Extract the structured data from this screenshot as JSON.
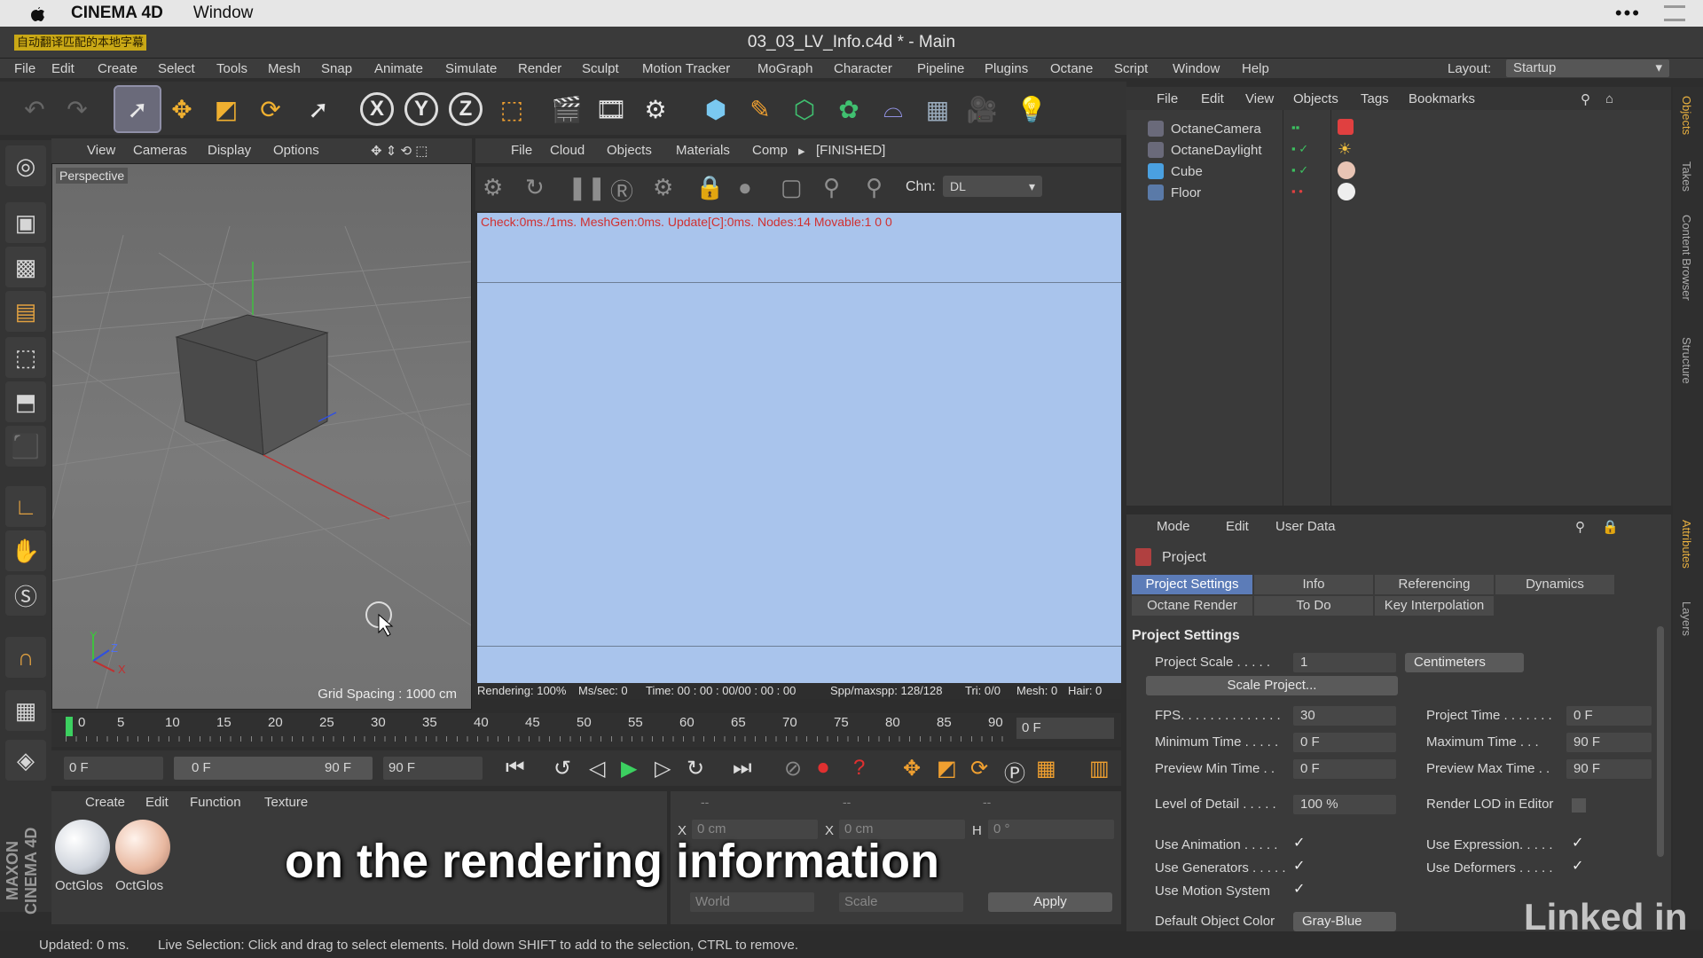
{
  "mac": {
    "app": "CINEMA 4D",
    "window_menu": "Window",
    "apple": "",
    "dots": "•••"
  },
  "window": {
    "title": "03_03_LV_Info.c4d * - Main",
    "watermark": "自动翻译匹配的本地字幕"
  },
  "menu": [
    "File",
    "Edit",
    "Create",
    "Select",
    "Tools",
    "Mesh",
    "Snap",
    "Animate",
    "Simulate",
    "Render",
    "Sculpt",
    "Motion Tracker",
    "MoGraph",
    "Character",
    "Pipeline",
    "Plugins",
    "Octane",
    "Script",
    "Window",
    "Help"
  ],
  "layout": {
    "label": "Layout:",
    "value": "Startup"
  },
  "toolbar": {
    "x": "X",
    "y": "Y",
    "z": "Z"
  },
  "viewport": {
    "menu": [
      "View",
      "Cameras",
      "Display",
      "Options"
    ],
    "label": "Perspective",
    "grid": "Grid Spacing : 1000 cm",
    "axis_y": "Y",
    "axis_z": "Z",
    "axis_x": "X"
  },
  "octane": {
    "menu": [
      "File",
      "Cloud",
      "Objects",
      "Materials",
      "Comp"
    ],
    "state": "[FINISHED]",
    "chn_label": "Chn:",
    "chn_value": "DL",
    "status": "Check:0ms./1ms. MeshGen:0ms. Update[C]:0ms. Nodes:14 Movable:1  0 0",
    "footer": {
      "rendering": "Rendering: 100%",
      "ms": "Ms/sec: 0",
      "time": "Time: 00 : 00 : 00/00 : 00 : 00",
      "spp": "Spp/maxspp: 128/128",
      "tri": "Tri: 0/0",
      "mesh": "Mesh: 0",
      "hair": "Hair: 0"
    }
  },
  "timeline": {
    "ticks": [
      "0",
      "5",
      "10",
      "15",
      "20",
      "25",
      "30",
      "35",
      "40",
      "45",
      "50",
      "55",
      "60",
      "65",
      "70",
      "75",
      "80",
      "85",
      "90"
    ],
    "frame": "0 F"
  },
  "playbar": {
    "start": "0 F",
    "range_start": "0 F",
    "range_end": "90 F",
    "end": "90 F"
  },
  "materials": {
    "menu": [
      "Create",
      "Edit",
      "Function",
      "Texture"
    ],
    "items": [
      {
        "name": "OctGlos"
      },
      {
        "name": "OctGlos"
      }
    ]
  },
  "coords": {
    "hdr": [
      "--",
      "--",
      "--"
    ],
    "x": "X",
    "x_val": "0 cm",
    "x2": "X",
    "x2_val": "0 cm",
    "h": "H",
    "h_val": "0 °",
    "world": "World",
    "scale": "Scale",
    "apply": "Apply"
  },
  "objects": {
    "menu": [
      "File",
      "Edit",
      "View",
      "Objects",
      "Tags",
      "Bookmarks"
    ],
    "items": [
      "OctaneCamera",
      "OctaneDaylight",
      "Cube",
      "Floor"
    ]
  },
  "attributes": {
    "menu": [
      "Mode",
      "Edit",
      "User Data"
    ],
    "title": "Project",
    "tabs": [
      "Project Settings",
      "Info",
      "Referencing",
      "Dynamics",
      "Octane Render",
      "To Do",
      "Key Interpolation"
    ],
    "section": "Project Settings",
    "project_scale_label": "Project Scale . . . . .",
    "project_scale": "1",
    "units": "Centimeters",
    "scale_btn": "Scale Project...",
    "fps_label": "FPS. . . . . . . . . . . . . .",
    "fps": "30",
    "ptime_label": "Project Time . . . . . . .",
    "ptime": "0 F",
    "mintime_label": "Minimum Time . . . . .",
    "mintime": "0 F",
    "maxtime_label": "Maximum Time . . .",
    "maxtime": "90 F",
    "pmin_label": "Preview Min Time . .",
    "pmin": "0 F",
    "pmax_label": "Preview Max Time . .",
    "pmax": "90 F",
    "lod_label": "Level of Detail . . . . .",
    "lod": "100 %",
    "rlod_label": "Render LOD in Editor",
    "useanim_label": "Use Animation . . . . .",
    "usegen_label": "Use Generators . . . . .",
    "usemotion_label": "Use Motion System",
    "useexpr_label": "Use Expression. . . . .",
    "usedef_label": "Use Deformers . . . . .",
    "objcolor_label": "Default Object Color",
    "objcolor": "Gray-Blue",
    "check": "✓"
  },
  "vtabs": [
    "Objects",
    "Takes",
    "Content Browser",
    "Structure",
    "Attributes",
    "Layers"
  ],
  "status": {
    "updated": "Updated: 0 ms.",
    "msg": "Live Selection: Click and drag to select elements. Hold down SHIFT to add to the selection, CTRL to remove."
  },
  "subtitle": "on the rendering information",
  "brand": {
    "linkedin": "Linked in",
    "maxon": "MAXON CINEMA 4D"
  }
}
